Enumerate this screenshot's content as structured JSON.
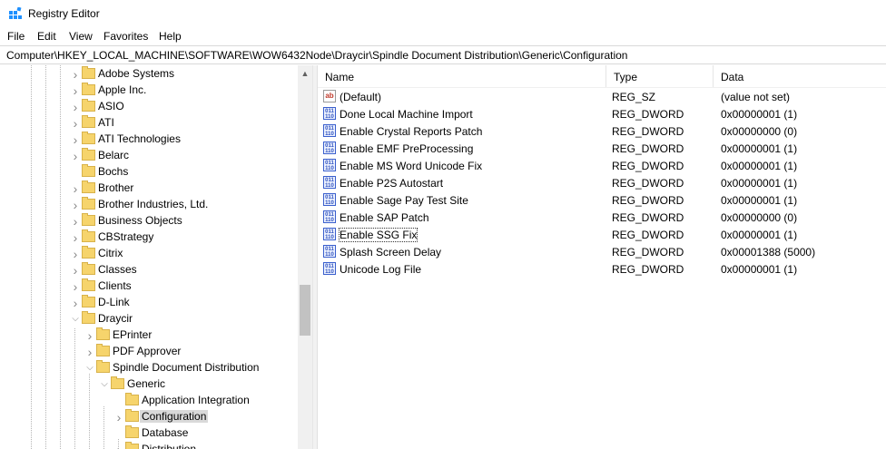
{
  "window": {
    "title": "Registry Editor",
    "icon": "registry-editor-icon"
  },
  "menu": [
    "File",
    "Edit",
    "View",
    "Favorites",
    "Help"
  ],
  "address": "Computer\\HKEY_LOCAL_MACHINE\\SOFTWARE\\WOW6432Node\\Draycir\\Spindle Document Distribution\\Generic\\Configuration",
  "tree": [
    {
      "label": "Adobe Systems",
      "expandable": true,
      "expanded": false,
      "depth": 0
    },
    {
      "label": "Apple Inc.",
      "expandable": true,
      "expanded": false,
      "depth": 0
    },
    {
      "label": "ASIO",
      "expandable": true,
      "expanded": false,
      "depth": 0
    },
    {
      "label": "ATI",
      "expandable": true,
      "expanded": false,
      "depth": 0
    },
    {
      "label": "ATI Technologies",
      "expandable": true,
      "expanded": false,
      "depth": 0
    },
    {
      "label": "Belarc",
      "expandable": true,
      "expanded": false,
      "depth": 0
    },
    {
      "label": "Bochs",
      "expandable": false,
      "expanded": false,
      "depth": 0
    },
    {
      "label": "Brother",
      "expandable": true,
      "expanded": false,
      "depth": 0
    },
    {
      "label": "Brother Industries, Ltd.",
      "expandable": true,
      "expanded": false,
      "depth": 0
    },
    {
      "label": "Business Objects",
      "expandable": true,
      "expanded": false,
      "depth": 0
    },
    {
      "label": "CBStrategy",
      "expandable": true,
      "expanded": false,
      "depth": 0
    },
    {
      "label": "Citrix",
      "expandable": true,
      "expanded": false,
      "depth": 0
    },
    {
      "label": "Classes",
      "expandable": true,
      "expanded": false,
      "depth": 0
    },
    {
      "label": "Clients",
      "expandable": true,
      "expanded": false,
      "depth": 0
    },
    {
      "label": "D-Link",
      "expandable": true,
      "expanded": false,
      "depth": 0
    },
    {
      "label": "Draycir",
      "expandable": true,
      "expanded": true,
      "depth": 0
    },
    {
      "label": "EPrinter",
      "expandable": true,
      "expanded": false,
      "depth": 1
    },
    {
      "label": "PDF Approver",
      "expandable": true,
      "expanded": false,
      "depth": 1
    },
    {
      "label": "Spindle Document Distribution",
      "expandable": true,
      "expanded": true,
      "depth": 1
    },
    {
      "label": "Generic",
      "expandable": true,
      "expanded": true,
      "depth": 2
    },
    {
      "label": "Application Integration",
      "expandable": false,
      "expanded": false,
      "depth": 3
    },
    {
      "label": "Configuration",
      "expandable": true,
      "expanded": false,
      "depth": 3,
      "selected": true
    },
    {
      "label": "Database",
      "expandable": false,
      "expanded": false,
      "depth": 3
    },
    {
      "label": "Distribution",
      "expandable": true,
      "expanded": false,
      "depth": 3
    }
  ],
  "columns": [
    "Name",
    "Type",
    "Data"
  ],
  "values": [
    {
      "name": "(Default)",
      "type": "REG_SZ",
      "data": "(value not set)",
      "icon": "string-value-icon"
    },
    {
      "name": "Done Local Machine Import",
      "type": "REG_DWORD",
      "data": "0x00000001 (1)",
      "icon": "dword-value-icon"
    },
    {
      "name": "Enable Crystal Reports Patch",
      "type": "REG_DWORD",
      "data": "0x00000000 (0)",
      "icon": "dword-value-icon"
    },
    {
      "name": "Enable EMF PreProcessing",
      "type": "REG_DWORD",
      "data": "0x00000001 (1)",
      "icon": "dword-value-icon"
    },
    {
      "name": "Enable MS Word Unicode Fix",
      "type": "REG_DWORD",
      "data": "0x00000001 (1)",
      "icon": "dword-value-icon"
    },
    {
      "name": "Enable P2S Autostart",
      "type": "REG_DWORD",
      "data": "0x00000001 (1)",
      "icon": "dword-value-icon"
    },
    {
      "name": "Enable Sage Pay Test Site",
      "type": "REG_DWORD",
      "data": "0x00000001 (1)",
      "icon": "dword-value-icon"
    },
    {
      "name": "Enable SAP Patch",
      "type": "REG_DWORD",
      "data": "0x00000000 (0)",
      "icon": "dword-value-icon"
    },
    {
      "name": "Enable SSG Fix",
      "type": "REG_DWORD",
      "data": "0x00000001 (1)",
      "icon": "dword-value-icon",
      "focused": true
    },
    {
      "name": "Splash Screen Delay",
      "type": "REG_DWORD",
      "data": "0x00001388 (5000)",
      "icon": "dword-value-icon"
    },
    {
      "name": "Unicode Log File",
      "type": "REG_DWORD",
      "data": "0x00000001 (1)",
      "icon": "dword-value-icon"
    }
  ],
  "icons": {
    "dword_glyph": "011\n110",
    "sz_glyph": "ab"
  },
  "colors": {
    "folder": "#f6d46c",
    "selection": "#d9d9d9"
  }
}
